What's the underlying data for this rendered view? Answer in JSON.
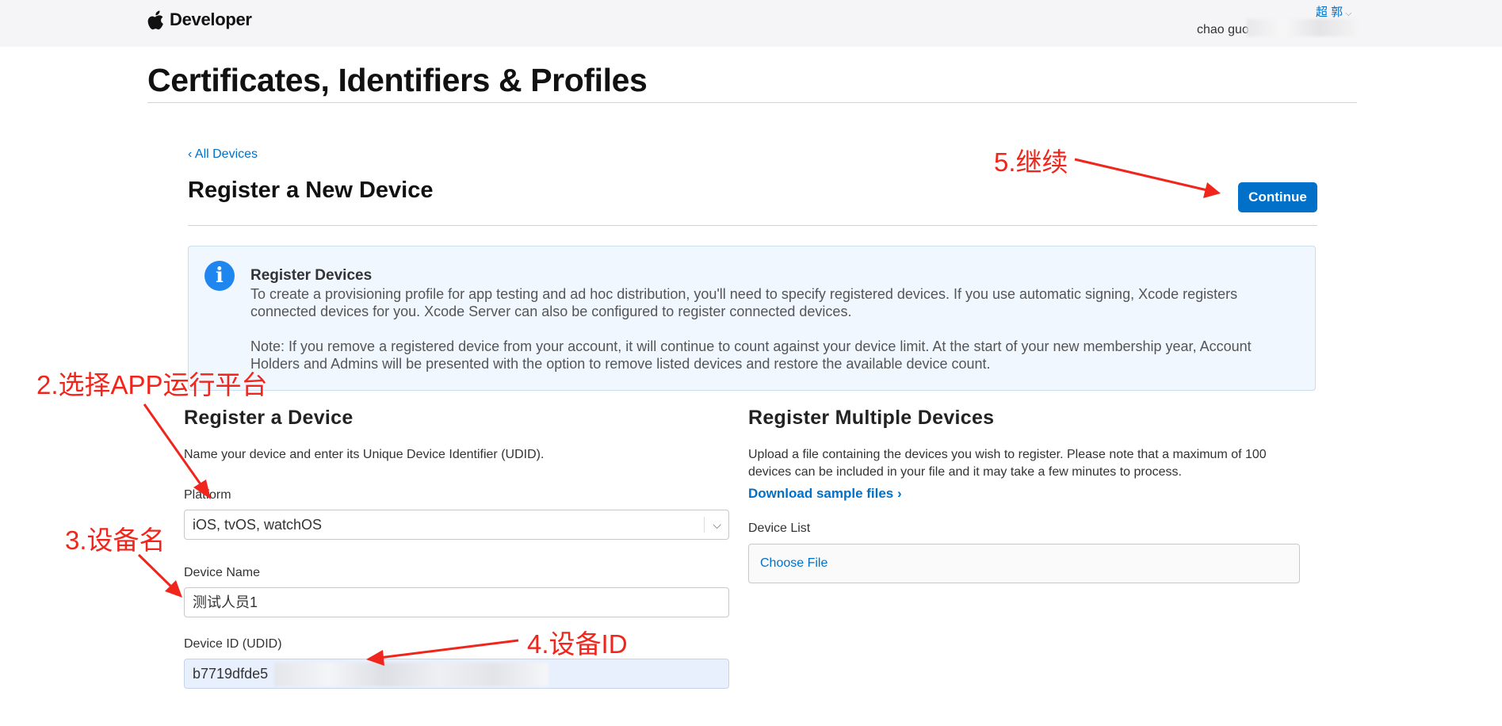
{
  "header": {
    "brand": "Developer",
    "user_name_zh": "超 郭",
    "user_name_en": "chao guo"
  },
  "page": {
    "title": "Certificates, Identifiers & Profiles",
    "back_link": "‹ All Devices",
    "section_title": "Register a New Device",
    "continue_label": "Continue"
  },
  "info": {
    "title": "Register Devices",
    "paragraph1": "To create a provisioning profile for app testing and ad hoc distribution, you'll need to specify registered devices. If you use automatic signing, Xcode registers connected devices for you. Xcode Server can also be configured to register connected devices.",
    "paragraph2": "Note: If you remove a registered device from your account, it will continue to count against your device limit. At the start of your new membership year, Account Holders and Admins will be presented with the option to remove listed devices and restore the available device count."
  },
  "single": {
    "title": "Register a Device",
    "description": "Name your device and enter its Unique Device Identifier (UDID).",
    "platform_label": "Platform",
    "platform_value": "iOS, tvOS, watchOS",
    "name_label": "Device Name",
    "name_value": "测试人员1",
    "udid_label": "Device ID (UDID)",
    "udid_value": "b7719dfde5"
  },
  "multiple": {
    "title": "Register Multiple Devices",
    "description": "Upload a file containing the devices you wish to register. Please note that a maximum of 100 devices can be included in your file and it may take a few minutes to process.",
    "download_link": "Download sample files ›",
    "list_label": "Device List",
    "choose_file": "Choose File"
  },
  "annotations": {
    "step2": "2.选择APP运行平台",
    "step3": "3.设备名",
    "step4": "4.设备ID",
    "step5": "5.继续",
    "color": "#f0261c"
  },
  "colors": {
    "accent": "#0070c9",
    "info_background": "#f0f7ff",
    "info_icon": "#1f86f0"
  }
}
